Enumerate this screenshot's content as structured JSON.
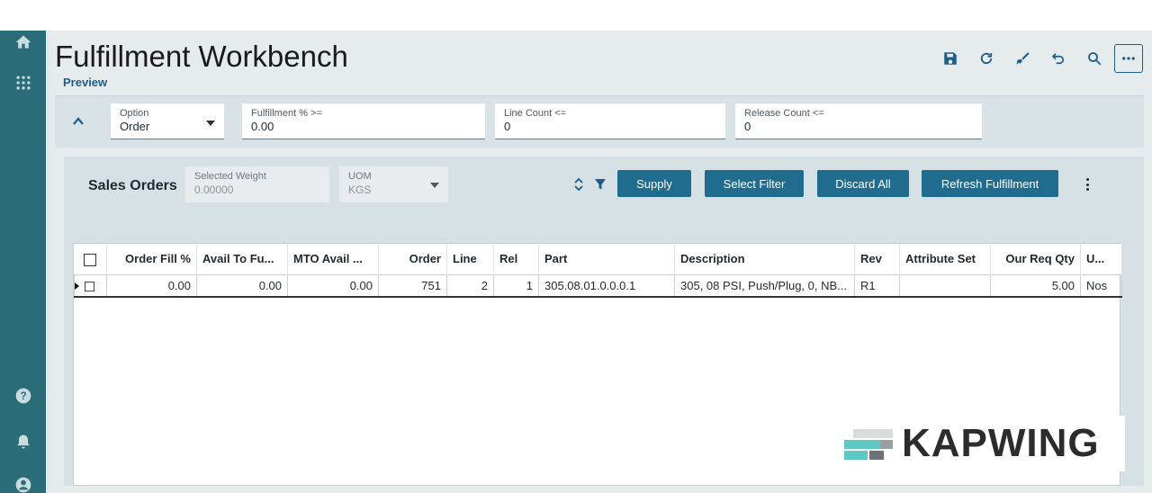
{
  "app": {
    "title": "Fulfillment Workbench",
    "subtitle": "Preview"
  },
  "nav": {
    "icons": [
      "home-icon",
      "apps-grid-icon",
      "help-icon",
      "bell-icon",
      "user-icon"
    ]
  },
  "toolbar": {
    "icons": [
      "save-icon",
      "refresh-icon",
      "clear-icon",
      "undo-icon",
      "search-icon",
      "more-icon"
    ]
  },
  "filters": {
    "option": {
      "label": "Option",
      "value": "Order"
    },
    "fulfillment_pct": {
      "label": "Fulfillment % >=",
      "value": "0.00"
    },
    "line_count": {
      "label": "Line Count <=",
      "value": "0"
    },
    "release_count": {
      "label": "Release Count <=",
      "value": "0"
    }
  },
  "sales_orders": {
    "title": "Sales Orders",
    "selected_weight": {
      "label": "Selected Weight",
      "value": "0.00000"
    },
    "uom": {
      "label": "UOM",
      "value": "KGS"
    },
    "buttons": {
      "supply": "Supply",
      "select_filter": "Select Filter",
      "discard_all": "Discard All",
      "refresh_fulfillment": "Refresh Fulfillment"
    },
    "columns": [
      "Order Fill %",
      "Avail To Fu...",
      "MTO Avail ...",
      "Order",
      "Line",
      "Rel",
      "Part",
      "Description",
      "Rev",
      "Attribute Set",
      "Our Req Qty",
      "U..."
    ],
    "rows": [
      [
        "0.00",
        "0.00",
        "0.00",
        "751",
        "2",
        "1",
        "305.08.01.0.0.0.1",
        "305, 08 PSI, Push/Plug, 0, NB...",
        "R1",
        "",
        "5.00",
        "Nos"
      ]
    ]
  },
  "watermark": {
    "text": "KAPWING"
  },
  "colors": {
    "nav": "#2a6d78",
    "accent": "#1c5d8c",
    "button": "#1f6c8f",
    "panel": "#d5e1e5"
  }
}
